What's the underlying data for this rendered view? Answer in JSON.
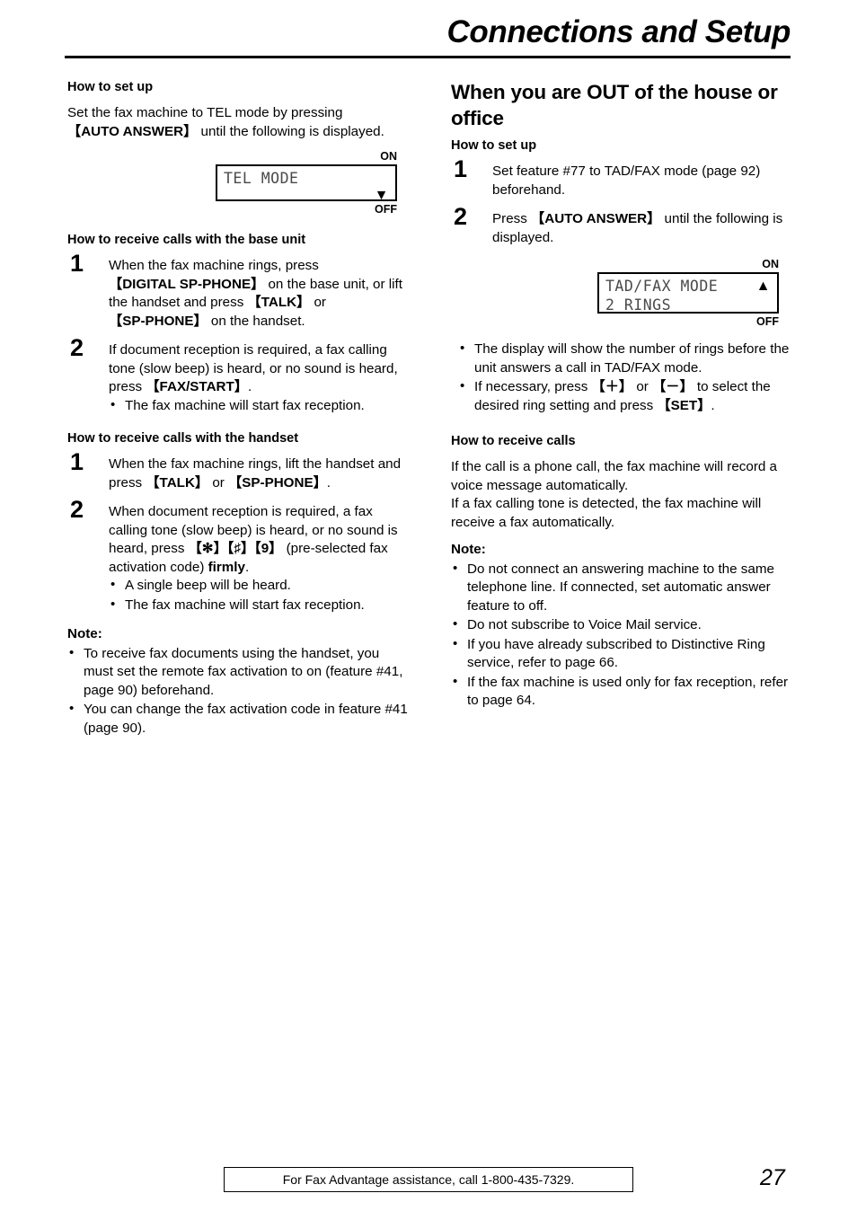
{
  "header": {
    "title": "Connections and Setup"
  },
  "left_column": {
    "setup": {
      "heading": "How to set up",
      "paragraph_part1": "Set the fax machine to TEL mode by pressing ",
      "key_auto_answer": "【AUTO ANSWER】",
      "paragraph_part2": " until the following is displayed."
    },
    "display_tel": {
      "label_on": "ON",
      "label_off": "OFF",
      "line1": "TEL MODE",
      "line2": "",
      "arrow": "▼"
    },
    "base_unit": {
      "heading": "How to receive calls with the base unit",
      "steps": [
        {
          "number": "1",
          "t1": "When the fax machine rings, press ",
          "k1": "【DIGITAL SP-PHONE】",
          "t2": " on the base unit, or lift the handset and press ",
          "k2": "【TALK】",
          "t3": " or ",
          "k3": "【SP-PHONE】",
          "t4": " on the handset."
        },
        {
          "number": "2",
          "t1": "If document reception is required, a fax calling tone (slow beep) is heard, or no sound is heard, press ",
          "k1": "【FAX/START】",
          "t2": ".",
          "bullets": [
            "The fax machine will start fax reception."
          ]
        }
      ]
    },
    "handset": {
      "heading": "How to receive calls with the handset",
      "steps": [
        {
          "number": "1",
          "t1": "When the fax machine rings, lift the handset and press ",
          "k1": "【TALK】",
          "t2": " or ",
          "k2": "【SP-PHONE】",
          "t3": "."
        },
        {
          "number": "2",
          "t1": "When document reception is required, a fax calling tone (slow beep) is heard, or no sound is heard, press ",
          "k1": "【✻】【♯】【9】",
          "t2": " (pre-selected fax activation code) ",
          "k2": "firmly",
          "t3": ".",
          "bullets": [
            "A single beep will be heard.",
            "The fax machine will start fax reception."
          ]
        }
      ]
    },
    "note": {
      "heading": "Note:",
      "items": [
        "To receive fax documents using the handset, you must set the remote fax activation to on (feature #41, page 90) beforehand.",
        "You can change the fax activation code in feature #41 (page 90)."
      ]
    }
  },
  "right_column": {
    "section_title": "When you are OUT of the house or office",
    "setup": {
      "heading": "How to set up",
      "steps": [
        {
          "number": "1",
          "t1": "Set feature #77 to TAD/FAX mode (page 92) beforehand."
        },
        {
          "number": "2",
          "t1": "Press ",
          "k1": "【AUTO ANSWER】",
          "t2": " until the following is displayed."
        }
      ]
    },
    "display_tad": {
      "label_on": "ON",
      "label_off": "OFF",
      "line1": "TAD/FAX MODE",
      "line2": "2 RINGS",
      "arrow": "▲"
    },
    "display_bullets": {
      "b1": "The display will show the number of rings before the unit answers a call in TAD/FAX mode.",
      "b2_t1": "If necessary, press ",
      "b2_k1": "【＋】",
      "b2_t2": " or ",
      "b2_k2": "【－】",
      "b2_t3": " to select the desired ring setting and press ",
      "b2_k3": "【SET】",
      "b2_t4": "."
    },
    "receive": {
      "heading": "How to receive calls",
      "paragraph": "If the call is a phone call, the fax machine will record a voice message automatically.\nIf a fax calling tone is detected, the fax machine will receive a fax automatically."
    },
    "note": {
      "heading": "Note:",
      "items": [
        "Do not connect an answering machine to the same telephone line. If connected, set automatic answer feature to off.",
        "Do not subscribe to Voice Mail service.",
        "If you have already subscribed to Distinctive Ring service, refer to page 66.",
        "If the fax machine is used only for fax reception, refer to page 64."
      ]
    }
  },
  "footer": {
    "assistance_text": "For Fax Advantage assistance, call 1-800-435-7329.",
    "page_number": "27"
  }
}
